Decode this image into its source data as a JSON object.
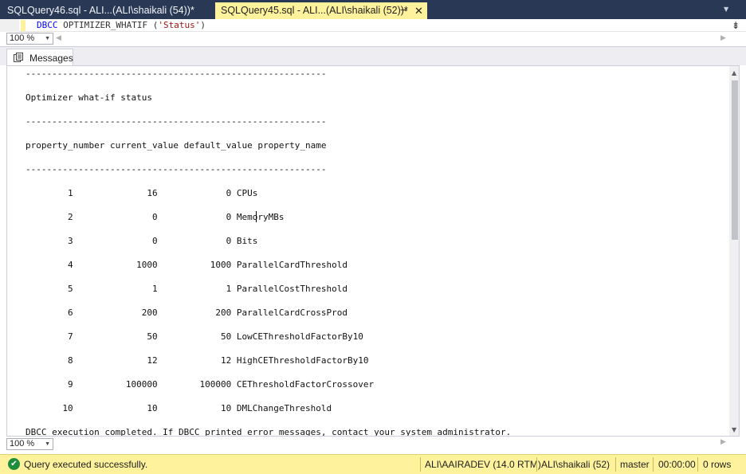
{
  "tabs": [
    {
      "title": "SQLQuery46.sql - ALI...(ALI\\shaikali (54))*",
      "active": false
    },
    {
      "title": "SQLQuery45.sql - ALI...(ALI\\shaikali (52))*",
      "active": true
    }
  ],
  "editor": {
    "keyword": "DBCC",
    "command": "OPTIMIZER_WHATIF",
    "open_paren": "(",
    "argument": "'Status'",
    "close_paren": ")"
  },
  "zoom_top": "100 %",
  "zoom_bottom": "100 %",
  "results_tab": {
    "label": "Messages"
  },
  "output_lines": [
    "---------------------------------------------------------",
    "Optimizer what-if status",
    "---------------------------------------------------------",
    "property_number current_value default_value property_name",
    "---------------------------------------------------------",
    "        1              16             0 CPUs",
    "        2               0             0 MemoryMBs",
    "        3               0             0 Bits",
    "        4            1000          1000 ParallelCardThreshold",
    "        5               1             1 ParallelCostThreshold",
    "        6             200           200 ParallelCardCrossProd",
    "        7              50            50 LowCEThresholdFactorBy10",
    "        8              12            12 HighCEThresholdFactorBy10",
    "        9          100000        100000 CEThresholdFactorCrossover",
    "       10              10            10 DMLChangeThreshold",
    "DBCC execution completed. If DBCC printed error messages, contact your system administrator."
  ],
  "status": {
    "message": "Query executed successfully.",
    "server": "ALI\\AAIRADEV (14.0 RTM)",
    "user": "ALI\\shaikali (52)",
    "database": "master",
    "elapsed": "00:00:00",
    "rows": "0 rows"
  },
  "colors": {
    "accent_yellow": "#fff29d",
    "tab_strip": "#293955",
    "keyword_blue": "#0000ff",
    "string_red": "#a31515",
    "success_green": "#1e8e3e"
  }
}
